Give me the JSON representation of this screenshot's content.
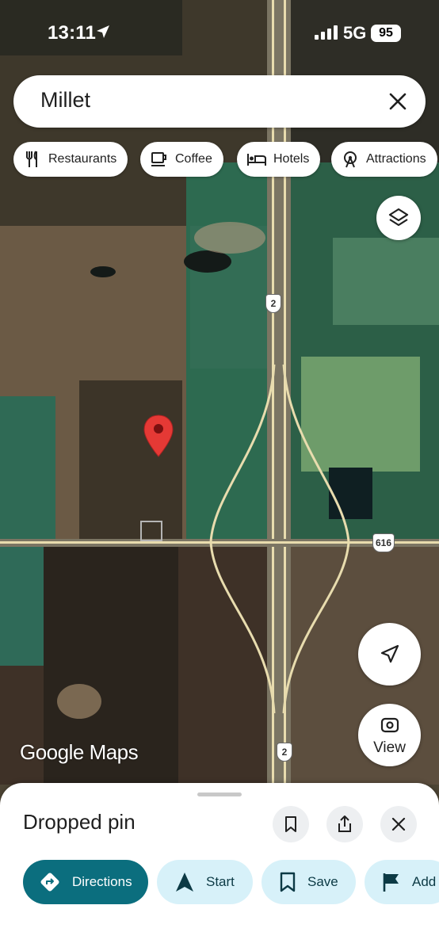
{
  "status_bar": {
    "time": "13:11",
    "network": "5G",
    "battery": "95"
  },
  "search": {
    "query": "Millet"
  },
  "chips": [
    {
      "label": "Restaurants",
      "icon": "restaurant-icon"
    },
    {
      "label": "Coffee",
      "icon": "coffee-icon"
    },
    {
      "label": "Hotels",
      "icon": "hotel-icon"
    },
    {
      "label": "Attractions",
      "icon": "attractions-icon"
    }
  ],
  "map": {
    "watermark": "Google Maps",
    "highway_shield": "2",
    "road_shield": "616",
    "view_label": "View",
    "pin_color": "#e53935"
  },
  "sheet": {
    "title": "Dropped pin",
    "actions": [
      {
        "label": "Directions",
        "icon": "directions-icon"
      },
      {
        "label": "Start",
        "icon": "navigation-icon"
      },
      {
        "label": "Save",
        "icon": "bookmark-icon"
      },
      {
        "label": "Add",
        "icon": "flag-icon"
      }
    ]
  },
  "colors": {
    "accent": "#0b6e7e",
    "accent_light": "#d7f1f9"
  }
}
